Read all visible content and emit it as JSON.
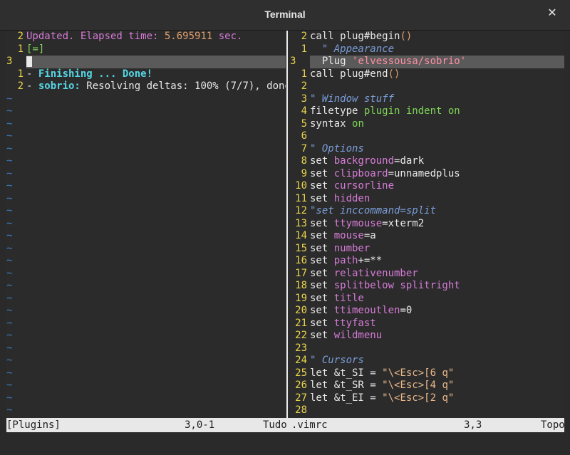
{
  "window": {
    "title": "Terminal",
    "close_glyph": "✕"
  },
  "left_pane": {
    "lines": [
      {
        "num": "2",
        "text_parts": [
          {
            "t": "Updated. Elapsed time: ",
            "c": "pink"
          },
          {
            "t": "5.695911",
            "c": "orange"
          },
          {
            "t": " sec.",
            "c": "pink"
          }
        ]
      },
      {
        "num": "1",
        "text_parts": [
          {
            "t": "[=]",
            "c": "green"
          }
        ]
      },
      {
        "num": "3",
        "current": true,
        "text_parts": []
      },
      {
        "num": "1",
        "text_parts": [
          {
            "t": "- ",
            "c": "white"
          },
          {
            "t": "Finishing ... Done!",
            "c": "cyan"
          }
        ]
      },
      {
        "num": "2",
        "text_parts": [
          {
            "t": "- ",
            "c": "white"
          },
          {
            "t": "sobrio:",
            "c": "cyan"
          },
          {
            "t": " Resolving deltas: 100% (7/7), done.",
            "c": "white"
          }
        ]
      }
    ],
    "tilde_count": 26,
    "tilde": "~"
  },
  "right_pane": {
    "lines": [
      {
        "num": "2",
        "parts": [
          {
            "t": "call plug#begin",
            "c": "white"
          },
          {
            "t": "()",
            "c": "orange"
          }
        ]
      },
      {
        "num": "1",
        "parts": [
          {
            "t": "  \" Appearance",
            "c": "comment"
          }
        ]
      },
      {
        "num": "3",
        "current": true,
        "parts": [
          {
            "t": "  Plug ",
            "c": "white"
          },
          {
            "t": "'elvessousa/sobrio'",
            "c": "strpink"
          }
        ]
      },
      {
        "num": "1",
        "parts": [
          {
            "t": "call plug#end",
            "c": "white"
          },
          {
            "t": "()",
            "c": "orange"
          }
        ]
      },
      {
        "num": "2",
        "parts": []
      },
      {
        "num": "3",
        "parts": [
          {
            "t": "\" Window stuff",
            "c": "comment"
          }
        ]
      },
      {
        "num": "4",
        "parts": [
          {
            "t": "filetype ",
            "c": "white"
          },
          {
            "t": "plugin indent on",
            "c": "green"
          }
        ]
      },
      {
        "num": "5",
        "parts": [
          {
            "t": "syntax ",
            "c": "white"
          },
          {
            "t": "on",
            "c": "green"
          }
        ]
      },
      {
        "num": "6",
        "parts": []
      },
      {
        "num": "7",
        "parts": [
          {
            "t": "\" Options",
            "c": "comment"
          }
        ]
      },
      {
        "num": "8",
        "parts": [
          {
            "t": "set ",
            "c": "white"
          },
          {
            "t": "background",
            "c": "opt"
          },
          {
            "t": "=dark",
            "c": "white"
          }
        ]
      },
      {
        "num": "9",
        "parts": [
          {
            "t": "set ",
            "c": "white"
          },
          {
            "t": "clipboard",
            "c": "opt"
          },
          {
            "t": "=unnamedplus",
            "c": "white"
          }
        ]
      },
      {
        "num": "10",
        "parts": [
          {
            "t": "set ",
            "c": "white"
          },
          {
            "t": "cursorline",
            "c": "opt"
          }
        ]
      },
      {
        "num": "11",
        "parts": [
          {
            "t": "set ",
            "c": "white"
          },
          {
            "t": "hidden",
            "c": "opt"
          }
        ]
      },
      {
        "num": "12",
        "parts": [
          {
            "t": "\"set inccommand=split",
            "c": "comment"
          }
        ]
      },
      {
        "num": "13",
        "parts": [
          {
            "t": "set ",
            "c": "white"
          },
          {
            "t": "ttymouse",
            "c": "opt"
          },
          {
            "t": "=xterm2",
            "c": "white"
          }
        ]
      },
      {
        "num": "14",
        "parts": [
          {
            "t": "set ",
            "c": "white"
          },
          {
            "t": "mouse",
            "c": "opt"
          },
          {
            "t": "=a",
            "c": "white"
          }
        ]
      },
      {
        "num": "15",
        "parts": [
          {
            "t": "set ",
            "c": "white"
          },
          {
            "t": "number",
            "c": "opt"
          }
        ]
      },
      {
        "num": "16",
        "parts": [
          {
            "t": "set ",
            "c": "white"
          },
          {
            "t": "path",
            "c": "opt"
          },
          {
            "t": "+=**",
            "c": "white"
          }
        ]
      },
      {
        "num": "17",
        "parts": [
          {
            "t": "set ",
            "c": "white"
          },
          {
            "t": "relativenumber",
            "c": "opt"
          }
        ]
      },
      {
        "num": "18",
        "parts": [
          {
            "t": "set ",
            "c": "white"
          },
          {
            "t": "splitbelow splitright",
            "c": "opt"
          }
        ]
      },
      {
        "num": "19",
        "parts": [
          {
            "t": "set ",
            "c": "white"
          },
          {
            "t": "title",
            "c": "opt"
          }
        ]
      },
      {
        "num": "20",
        "parts": [
          {
            "t": "set ",
            "c": "white"
          },
          {
            "t": "ttimeoutlen",
            "c": "opt"
          },
          {
            "t": "=0",
            "c": "white"
          }
        ]
      },
      {
        "num": "21",
        "parts": [
          {
            "t": "set ",
            "c": "white"
          },
          {
            "t": "ttyfast",
            "c": "opt"
          }
        ]
      },
      {
        "num": "22",
        "parts": [
          {
            "t": "set ",
            "c": "white"
          },
          {
            "t": "wildmenu",
            "c": "opt"
          }
        ]
      },
      {
        "num": "23",
        "parts": []
      },
      {
        "num": "24",
        "parts": [
          {
            "t": "\" Cursors",
            "c": "comment"
          }
        ]
      },
      {
        "num": "25",
        "parts": [
          {
            "t": "let &t_SI = ",
            "c": "white"
          },
          {
            "t": "\"\\<Esc>[6 q\"",
            "c": "str"
          }
        ]
      },
      {
        "num": "26",
        "parts": [
          {
            "t": "let &t_SR = ",
            "c": "white"
          },
          {
            "t": "\"\\<Esc>[4 q\"",
            "c": "str"
          }
        ]
      },
      {
        "num": "27",
        "parts": [
          {
            "t": "let &t_EI = ",
            "c": "white"
          },
          {
            "t": "\"\\<Esc>[2 q\"",
            "c": "str"
          }
        ]
      },
      {
        "num": "28",
        "parts": []
      }
    ]
  },
  "statusline": {
    "left_name": "[Plugins]",
    "left_pos": "3,0-1",
    "left_scroll": "Tudo",
    "right_name": ".vimrc",
    "right_pos": "3,3",
    "right_scroll": "Topo"
  },
  "colors": {
    "line_number": "#e8d44d",
    "tilde": "#3b7fc4",
    "statusbar_bg": "#e8e8e8"
  }
}
